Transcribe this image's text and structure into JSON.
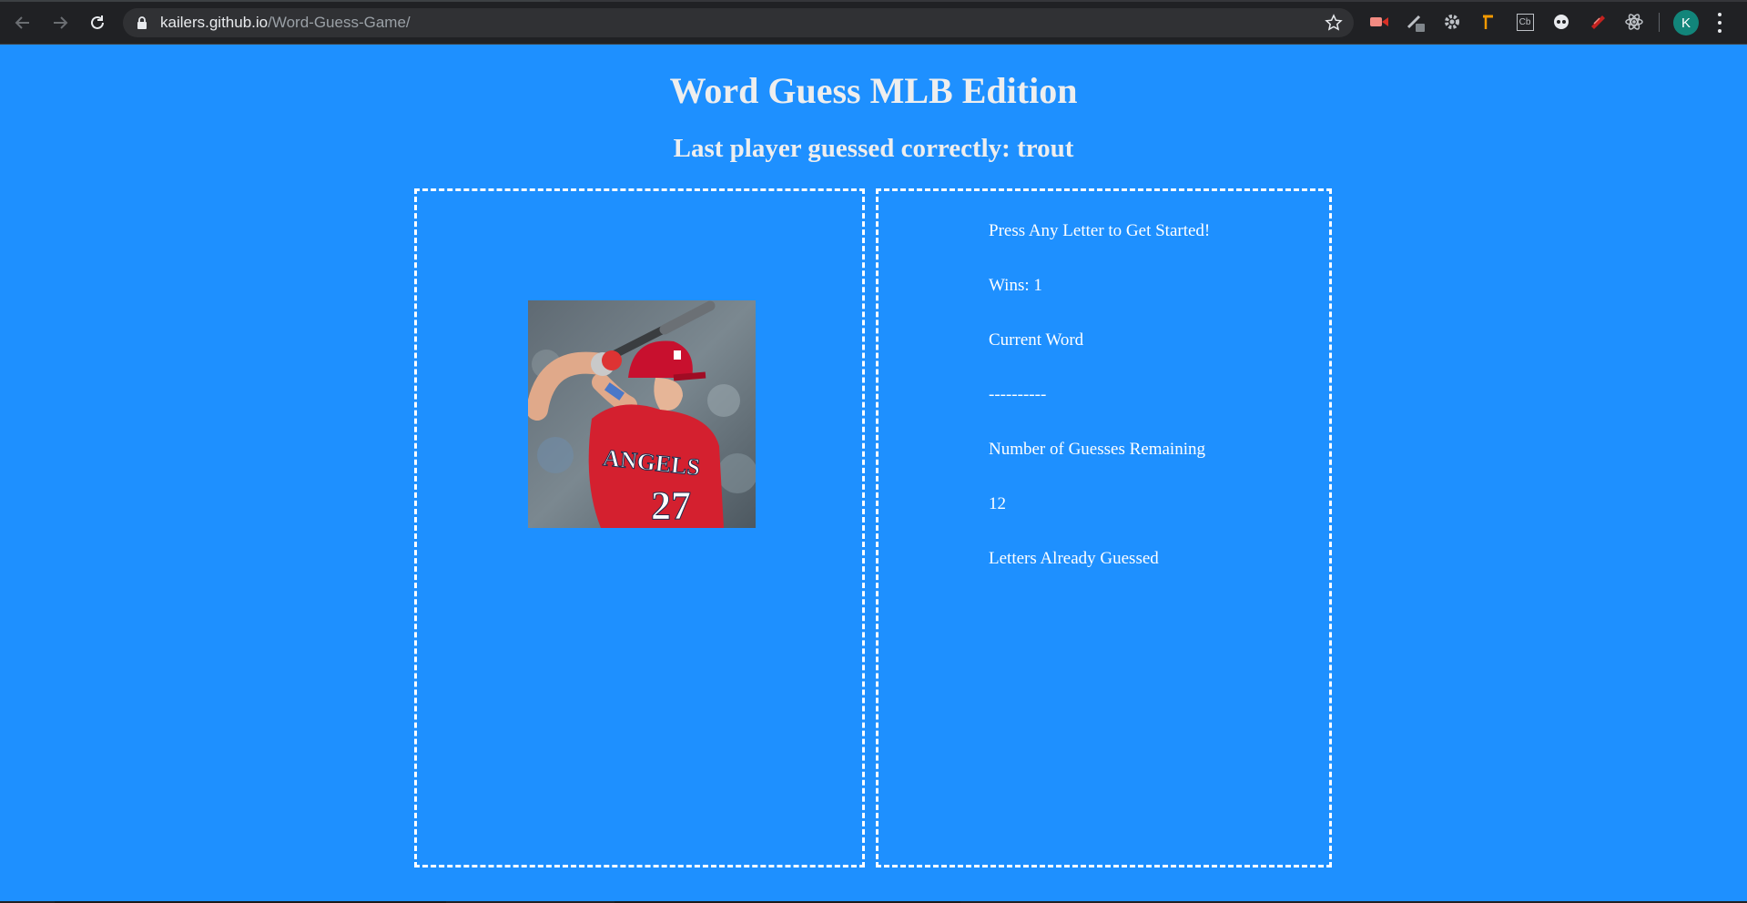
{
  "browser": {
    "url_host": "kailers.github.io",
    "url_path": "/Word-Guess-Game/",
    "profile_initial": "K",
    "extensions": [
      "video-extension-icon",
      "pen-extension-icon",
      "gear-extension-icon",
      "hammer-extension-icon",
      "cb-extension-icon",
      "circle-extension-icon",
      "ruby-extension-icon",
      "react-extension-icon"
    ],
    "cb_label": "Cb"
  },
  "page": {
    "title": "Word Guess MLB Edition",
    "subtitle": "Last player guessed correctly: trout"
  },
  "game": {
    "prompt": "Press Any Letter to Get Started!",
    "wins": "Wins: 1",
    "current_word_label": "Current Word",
    "current_word": "----------",
    "guesses_label": "Number of Guesses Remaining",
    "guesses_remaining": "12",
    "letters_guessed_label": "Letters Already Guessed"
  },
  "colors": {
    "background": "#1e90ff",
    "border": "#ffffff",
    "chrome": "#202124"
  }
}
